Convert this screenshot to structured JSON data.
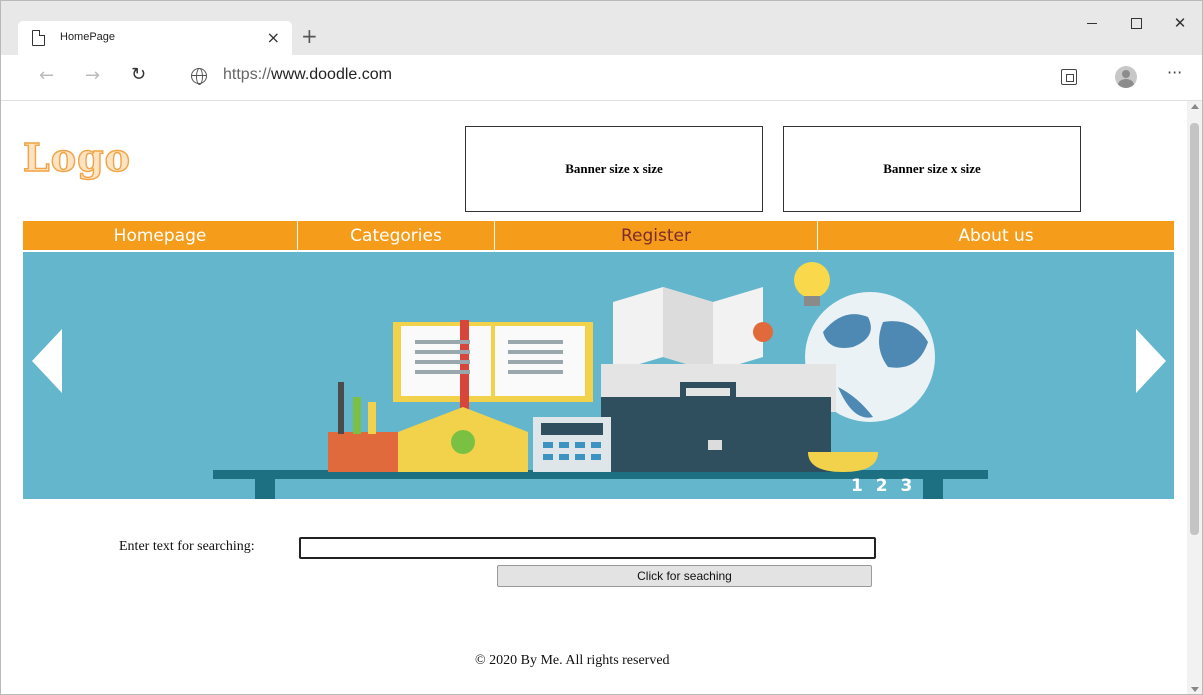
{
  "browser": {
    "tab_title": "HomePage",
    "tab_close": "×",
    "new_tab": "+",
    "url_protocol": "https://",
    "url_host": "www.doodle.com",
    "back": "←",
    "forward": "→",
    "refresh": "↻",
    "more": "···",
    "window_close": "✕"
  },
  "header": {
    "logo_text": "Logo",
    "banners": [
      "Banner size x size",
      "Banner size x size"
    ]
  },
  "menu": {
    "items": [
      {
        "label": "Homepage",
        "active": false
      },
      {
        "label": "Categories",
        "active": false
      },
      {
        "label": "Register",
        "active": true
      },
      {
        "label": "About us",
        "active": false
      }
    ]
  },
  "slider": {
    "pages": [
      "1",
      "2",
      "3"
    ]
  },
  "search": {
    "label": "Enter text for searching:",
    "value": "",
    "button_label": "Click for seaching"
  },
  "footer": {
    "text": "© 2020 By Me. All rights reserved"
  },
  "colors": {
    "menu_bg": "#f59c1a",
    "menu_active_text": "#7b2c2c",
    "slider_bg": "#63b6cc",
    "logo_fill": "#fde3c2",
    "logo_stroke": "#f0a445"
  }
}
